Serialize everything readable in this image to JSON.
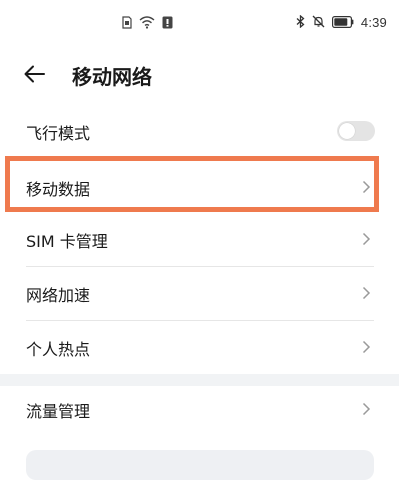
{
  "status_bar": {
    "time": "4:39",
    "left_icons": [
      "sim-icon",
      "wifi-icon",
      "notification-icon"
    ],
    "right_icons": [
      "bluetooth-icon",
      "mute-icon",
      "battery-icon"
    ]
  },
  "header": {
    "title": "移动网络",
    "back_icon": "arrow-left-icon"
  },
  "list": {
    "airplane_mode": {
      "label": "飞行模式",
      "toggle_on": false
    },
    "mobile_data": {
      "label": "移动数据"
    },
    "sim_management": {
      "label": "SIM 卡管理"
    },
    "network_boost": {
      "label": "网络加速"
    },
    "hotspot": {
      "label": "个人热点"
    },
    "data_management": {
      "label": "流量管理"
    }
  },
  "colors": {
    "highlight": "#ef7a4e",
    "toggle_off": "#e4e4e4",
    "section_gap": "#f1f3f5",
    "divider": "#e6e6e6"
  }
}
